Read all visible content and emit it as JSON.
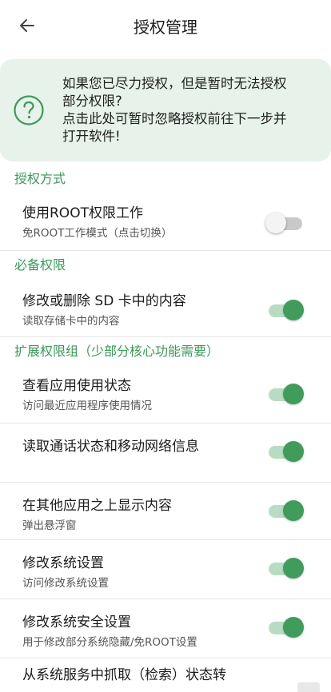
{
  "header": {
    "title": "授权管理",
    "back_icon": "arrow-left-icon"
  },
  "notice": {
    "icon": "question-circle-icon",
    "lines": [
      "如果您已尽力授权，但是暂时无法授权",
      "部分权限?",
      "点击此处可暂时忽略授权前往下一步并",
      "打开软件!"
    ]
  },
  "sections": {
    "auth_method": {
      "title": "授权方式",
      "items": [
        {
          "title": "使用ROOT权限工作",
          "subtitle": "免ROOT工作模式（点击切换）",
          "enabled": false
        }
      ]
    },
    "required": {
      "title": "必备权限",
      "items": [
        {
          "title": "修改或删除 SD 卡中的内容",
          "subtitle": "读取存储卡中的内容",
          "enabled": true
        }
      ]
    },
    "extended": {
      "title": "扩展权限组（少部分核心功能需要）",
      "items": [
        {
          "title": "查看应用使用状态",
          "subtitle": "访问最近应用程序使用情况",
          "enabled": true
        },
        {
          "title": "读取通话状态和移动网络信息",
          "subtitle": "",
          "enabled": true
        },
        {
          "title": "在其他应用之上显示内容",
          "subtitle": "弹出悬浮窗",
          "enabled": true
        },
        {
          "title": "修改系统设置",
          "subtitle": "访问修改系统设置",
          "enabled": true
        },
        {
          "title": "修改系统安全设置",
          "subtitle": "用于修改部分系统隐藏/免ROOT设置",
          "enabled": true
        },
        {
          "title": "从系统服务中抓取（检索）状态转"
        }
      ]
    }
  },
  "colors": {
    "accent": "#3f9c5a",
    "section_title": "#3a9a57",
    "notice_bg": "#e6f2ea"
  }
}
